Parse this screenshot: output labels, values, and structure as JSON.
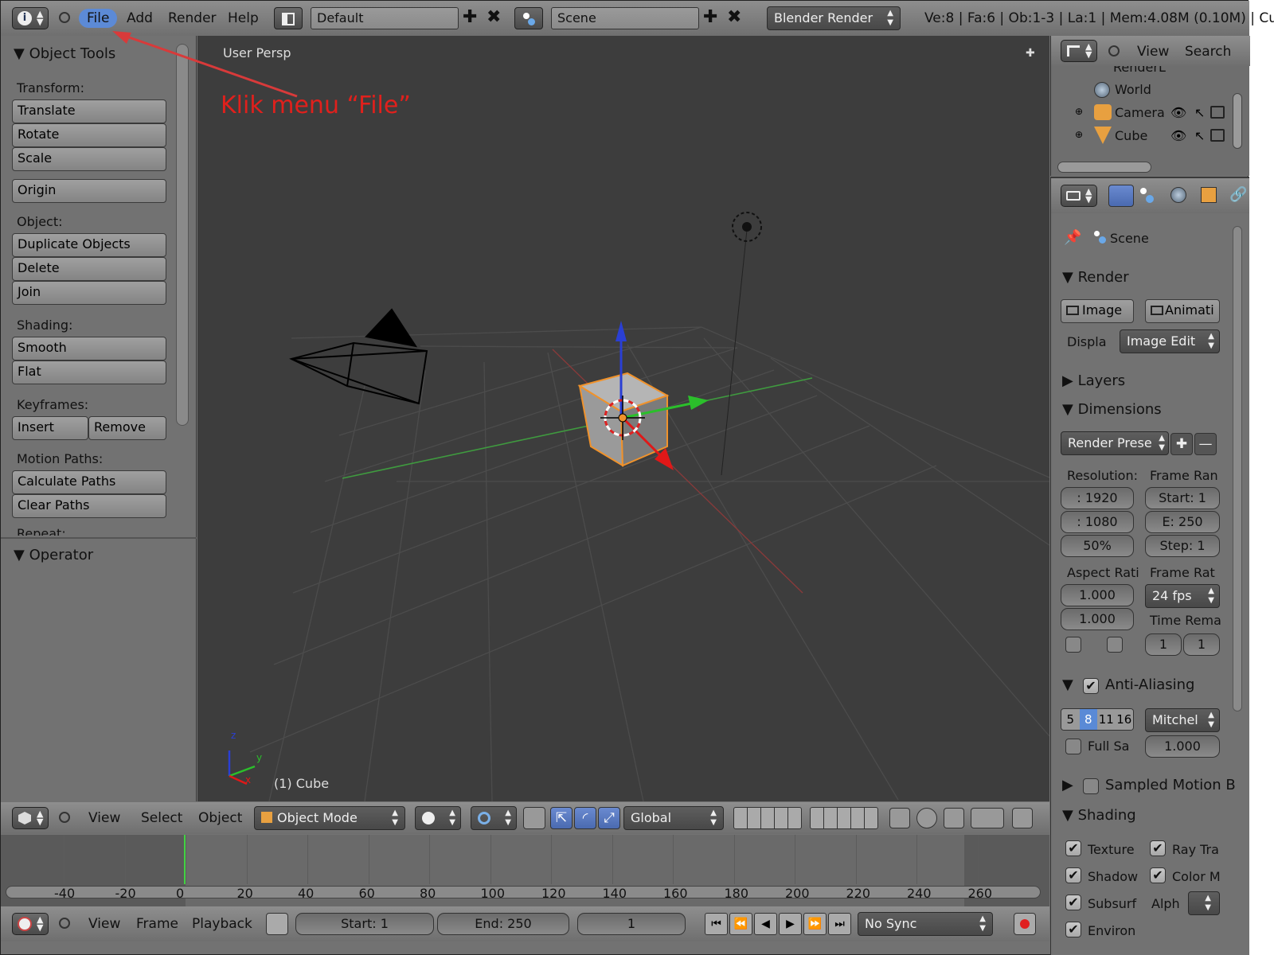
{
  "top_bar": {
    "menus": [
      "File",
      "Add",
      "Render",
      "Help"
    ],
    "screen_layout": "Default",
    "scene": "Scene",
    "render_engine": "Blender Render",
    "stats": "Ve:8 | Fa:6 | Ob:1-3 | La:1 | Mem:4.08M (0.10M) | Cu"
  },
  "annotation": {
    "text": "Klik menu “File”",
    "color": "#e0201c"
  },
  "tool_panel": {
    "title": "Object Tools",
    "transform_label": "Transform:",
    "translate": "Translate",
    "rotate": "Rotate",
    "scale": "Scale",
    "origin": "Origin",
    "object_label": "Object:",
    "duplicate": "Duplicate Objects",
    "delete": "Delete",
    "join": "Join",
    "shading_label": "Shading:",
    "smooth": "Smooth",
    "flat": "Flat",
    "keyframes_label": "Keyframes:",
    "insert": "Insert",
    "remove": "Remove",
    "motion_paths_label": "Motion Paths:",
    "calculate_paths": "Calculate Paths",
    "clear_paths": "Clear Paths",
    "repeat_label": "Repeat:",
    "operator_title": "Operator"
  },
  "viewport": {
    "view_name": "User Persp",
    "object_label": "(1) Cube",
    "axis_x": "x",
    "axis_y": "y",
    "axis_z": "z"
  },
  "view3d_header": {
    "menus": [
      "View",
      "Select",
      "Object"
    ],
    "mode": "Object Mode",
    "orientation": "Global"
  },
  "timeline": {
    "ticks": [
      "-40",
      "-20",
      "0",
      "20",
      "40",
      "60",
      "80",
      "100",
      "120",
      "140",
      "160",
      "180",
      "200",
      "220",
      "240",
      "260"
    ],
    "current_frame_value": 0
  },
  "timeline_header": {
    "menus": [
      "View",
      "Frame",
      "Playback"
    ],
    "start": "Start: 1",
    "end": "End: 250",
    "current": "1",
    "sync": "No Sync"
  },
  "outliner": {
    "view": "View",
    "search": "Search",
    "items": [
      "RenderL",
      "World",
      "Camera",
      "Cube"
    ]
  },
  "properties": {
    "scene_path": "Scene",
    "render_header": "Render",
    "image_btn": "Image",
    "anim_btn": "Animati",
    "display_label": "Displa",
    "display_value": "Image Edit",
    "layers_header": "Layers",
    "dimensions_header": "Dimensions",
    "render_presets": "Render Prese",
    "resolution_label": "Resolution:",
    "frame_range_label": "Frame Ran",
    "res_x": ": 1920",
    "res_y": ": 1080",
    "res_pct": "50%",
    "frame_start": "Start: 1",
    "frame_end": "E: 250",
    "frame_step": "Step: 1",
    "aspect_label": "Aspect Rati",
    "frame_rate_label": "Frame Rat",
    "aspect_x": "1.000",
    "aspect_y": "1.000",
    "fps": "24 fps",
    "time_remap_label": "Time Rema",
    "remap_old": "1",
    "remap_new": "1",
    "aa_header": "Anti-Aliasing",
    "aa_samples": [
      "5",
      "8",
      "11",
      "16"
    ],
    "aa_filter": "Mitchel",
    "full_sample": "Full Sa",
    "filter_size": "1.000",
    "sampled_motion": "Sampled Motion B",
    "shading_header": "Shading",
    "texture": "Texture",
    "ray_trace": "Ray Tra",
    "shadow": "Shadow",
    "color_manage": "Color M",
    "subsurf": "Subsurf",
    "alpha": "Alph",
    "environ": "Environ"
  }
}
